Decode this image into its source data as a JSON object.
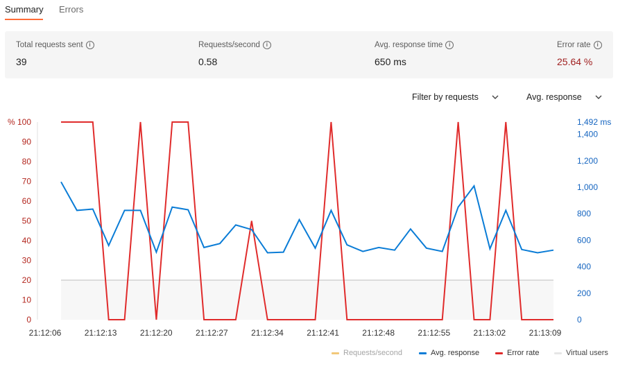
{
  "tabs": [
    {
      "label": "Summary",
      "active": true
    },
    {
      "label": "Errors",
      "active": false
    }
  ],
  "summary": {
    "total_requests": {
      "label": "Total requests sent",
      "value": "39"
    },
    "requests_per_second": {
      "label": "Requests/second",
      "value": "0.58"
    },
    "avg_response_time": {
      "label": "Avg. response time",
      "value": "650 ms"
    },
    "error_rate": {
      "label": "Error rate",
      "value": "25.64 %"
    }
  },
  "filters": {
    "requests_label": "Filter by requests",
    "metric_label": "Avg. response"
  },
  "legend": [
    {
      "label": "Requests/second",
      "color": "#f2c879"
    },
    {
      "label": "Avg. response",
      "color": "#0a7cd6"
    },
    {
      "label": "Error rate",
      "color": "#e02b2b"
    },
    {
      "label": "Virtual users",
      "color": "#e6e6e6"
    }
  ],
  "colors": {
    "error": "#e02b2b",
    "response": "#0a7cd6",
    "virtual_users": "#dcdcdc",
    "accent": "#ff6c37"
  },
  "chart_data": {
    "type": "line",
    "x": [
      "21:12:06",
      "21:12:08",
      "21:12:10",
      "21:12:12",
      "21:12:14",
      "21:12:16",
      "21:12:18",
      "21:12:20",
      "21:12:22",
      "21:12:24",
      "21:12:26",
      "21:12:28",
      "21:12:30",
      "21:12:32",
      "21:12:34",
      "21:12:36",
      "21:12:38",
      "21:12:40",
      "21:12:42",
      "21:12:44",
      "21:12:46",
      "21:12:48",
      "21:12:50",
      "21:12:52",
      "21:12:54",
      "21:12:56",
      "21:12:58",
      "21:13:00",
      "21:13:02",
      "21:13:04",
      "21:13:06",
      "21:13:08"
    ],
    "x_tick_labels": [
      "21:12:06",
      "21:12:13",
      "21:12:20",
      "21:12:27",
      "21:12:34",
      "21:12:41",
      "21:12:48",
      "21:12:55",
      "21:13:02",
      "21:13:09"
    ],
    "left_axis": {
      "ticks": [
        "% 100",
        "90",
        "80",
        "70",
        "60",
        "50",
        "40",
        "30",
        "20",
        "10",
        "0"
      ],
      "range": [
        0,
        100
      ]
    },
    "right_axis": {
      "ticks": [
        "1,492 ms",
        "1,400",
        "1,200",
        "1,000",
        "800",
        "600",
        "400",
        "200",
        "0"
      ],
      "range": [
        0,
        1492
      ]
    },
    "series": [
      {
        "name": "Error rate",
        "axis": "left",
        "color": "#e02b2b",
        "values": [
          100,
          100,
          100,
          0,
          0,
          100,
          0,
          100,
          100,
          0,
          0,
          0,
          50,
          0,
          0,
          0,
          0,
          100,
          0,
          0,
          0,
          0,
          0,
          0,
          0,
          100,
          0,
          0,
          100,
          0,
          0,
          0
        ]
      },
      {
        "name": "Avg. response",
        "axis": "right",
        "color": "#0a7cd6",
        "values": [
          1040,
          825,
          835,
          560,
          825,
          825,
          510,
          850,
          830,
          545,
          575,
          715,
          680,
          505,
          510,
          755,
          540,
          825,
          565,
          515,
          545,
          525,
          685,
          540,
          515,
          850,
          1010,
          535,
          825,
          530,
          505,
          525
        ]
      },
      {
        "name": "Virtual users",
        "axis": "left",
        "color": "#dcdcdc",
        "values": [
          20,
          20,
          20,
          20,
          20,
          20,
          20,
          20,
          20,
          20,
          20,
          20,
          20,
          20,
          20,
          20,
          20,
          20,
          20,
          20,
          20,
          20,
          20,
          20,
          20,
          20,
          20,
          20,
          20,
          20,
          20,
          20
        ]
      }
    ]
  }
}
